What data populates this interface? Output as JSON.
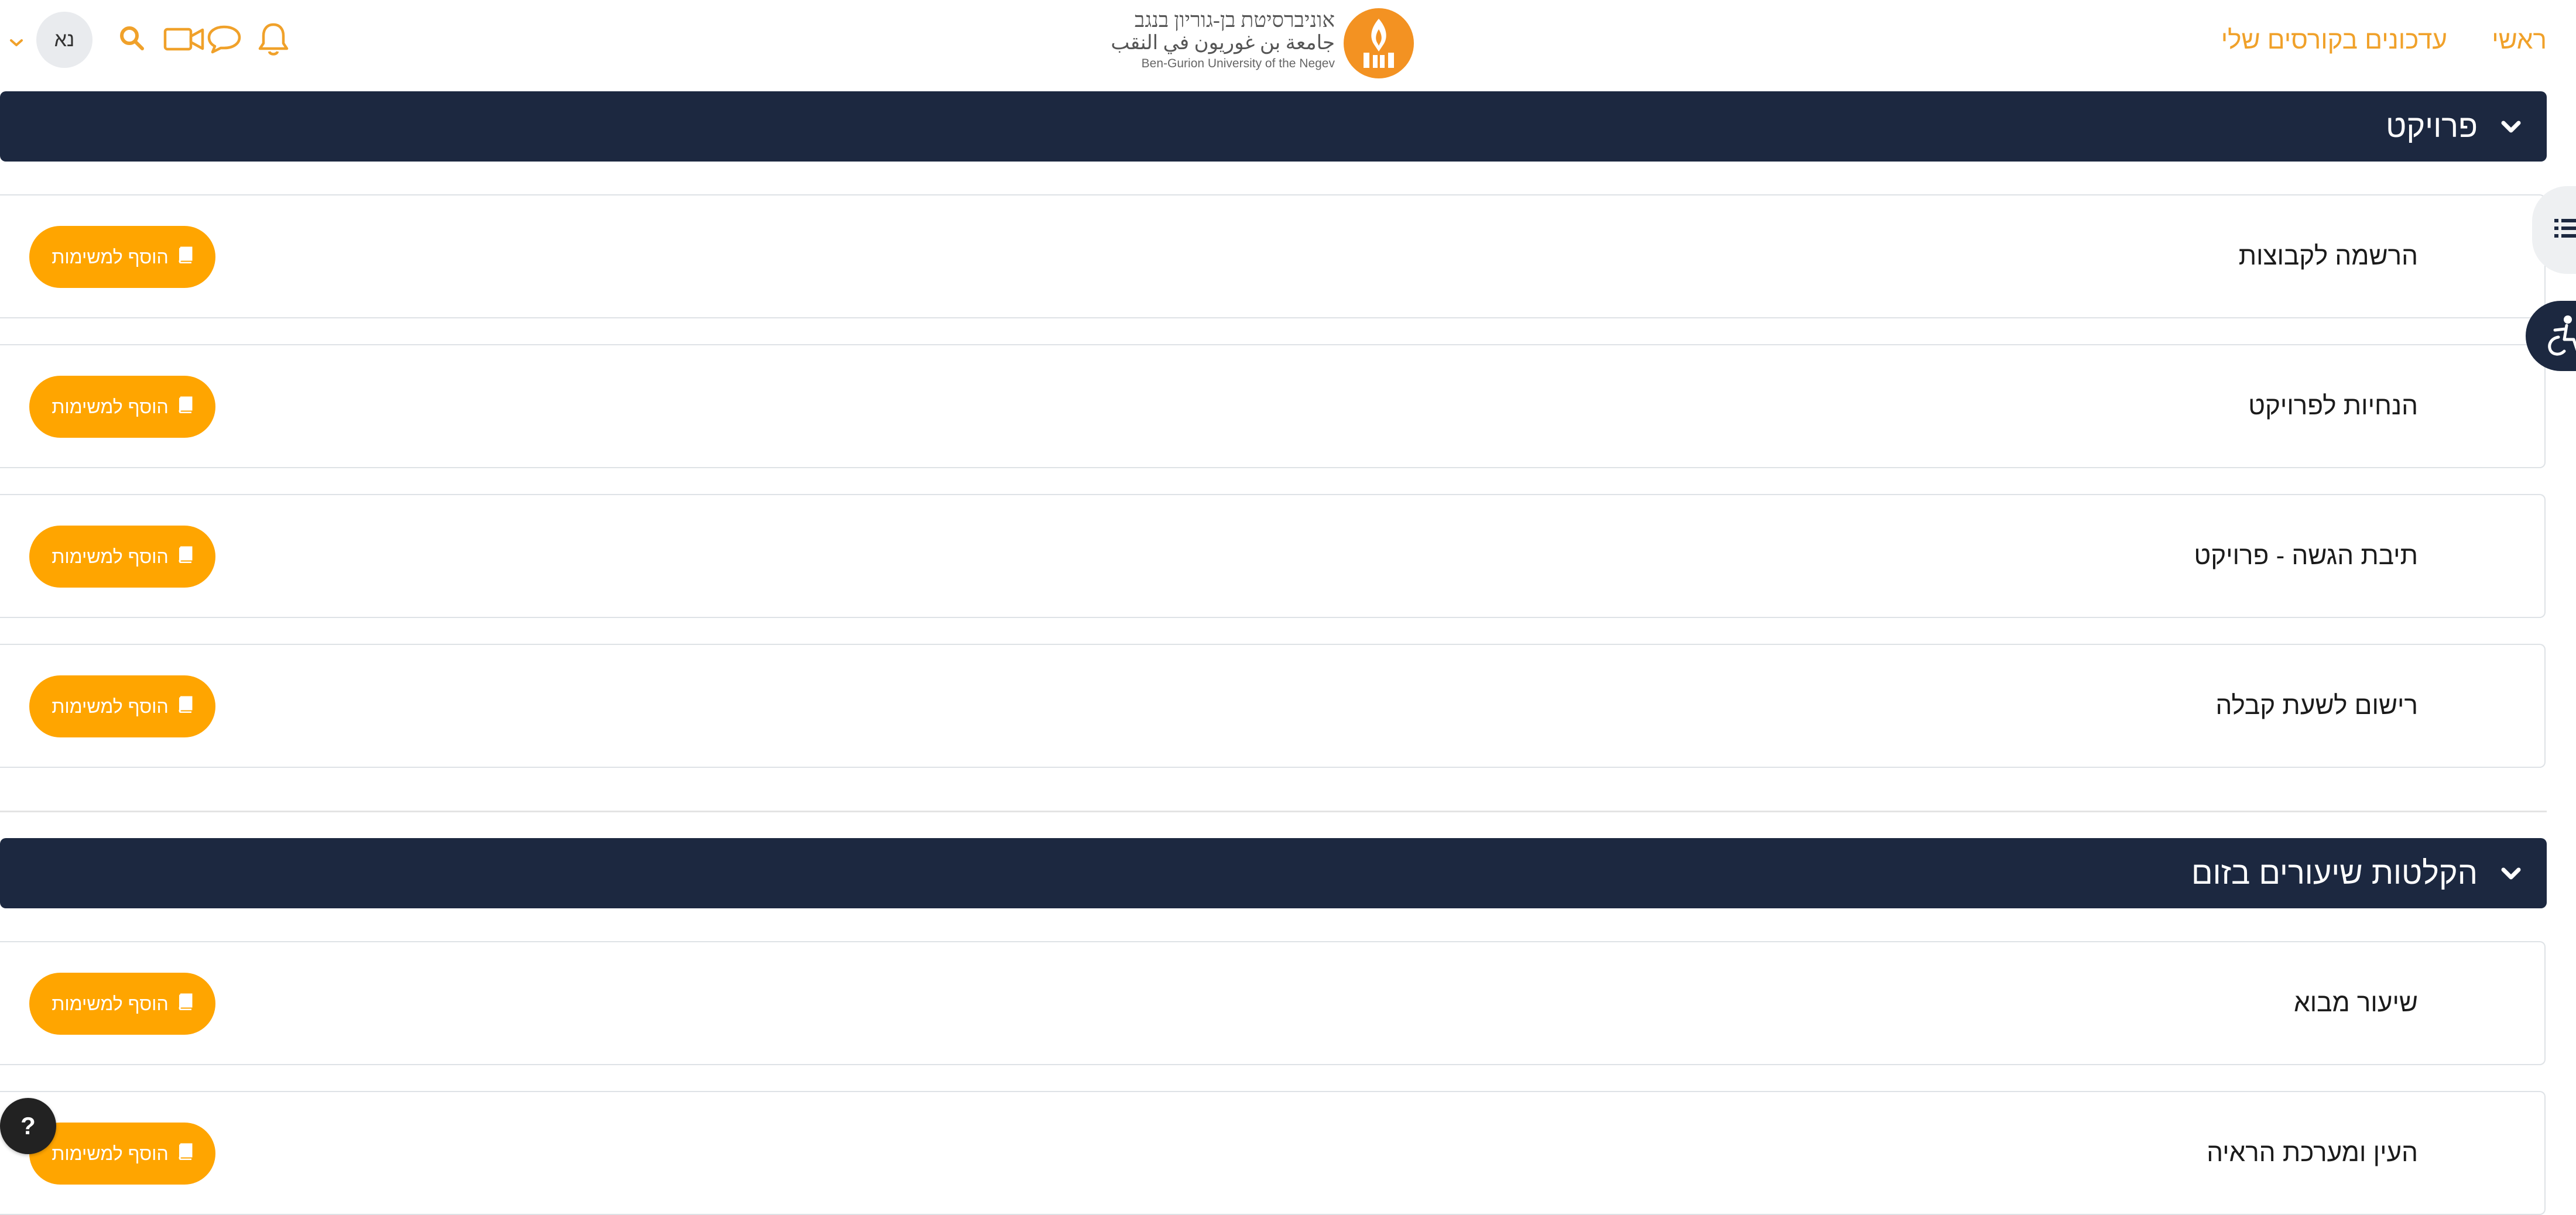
{
  "nav": {
    "home": "ראשי",
    "course_updates": "עדכונים בקורסים שלי",
    "avatar_initials": "נא"
  },
  "logo": {
    "hebrew": "אוניברסיטת בן-גוריון בנגב",
    "arabic": "جامعة بن غوريون في النقب",
    "english": "Ben-Gurion University of the Negev"
  },
  "sections": [
    {
      "title": "פרויקט",
      "activities": [
        {
          "title": "הרשמה לקבוצות",
          "button": "הוסף למשימות"
        },
        {
          "title": "הנחיות לפרויקט",
          "button": "הוסף למשימות"
        },
        {
          "title": "תיבת הגשה - פרויקט",
          "button": "הוסף למשימות"
        },
        {
          "title": "רישום לשעת קבלה",
          "button": "הוסף למשימות"
        }
      ]
    },
    {
      "title": "הקלטות שיעורים בזום",
      "activities": [
        {
          "title": "שיעור מבוא",
          "button": "הוסף למשימות"
        },
        {
          "title": "העין ומערכת הראיה",
          "button": "הוסף למשימות"
        }
      ]
    }
  ],
  "help": {
    "label": "?"
  },
  "colors": {
    "accent": "#ffa500",
    "nav_link": "#f0a12a",
    "section_header": "#1c2840",
    "logo": "#f39222"
  },
  "icons": [
    "bell-icon",
    "chat-icon",
    "video-icon",
    "search-icon",
    "chevron-down-icon",
    "book-icon",
    "list-icon",
    "accessibility-icon"
  ]
}
